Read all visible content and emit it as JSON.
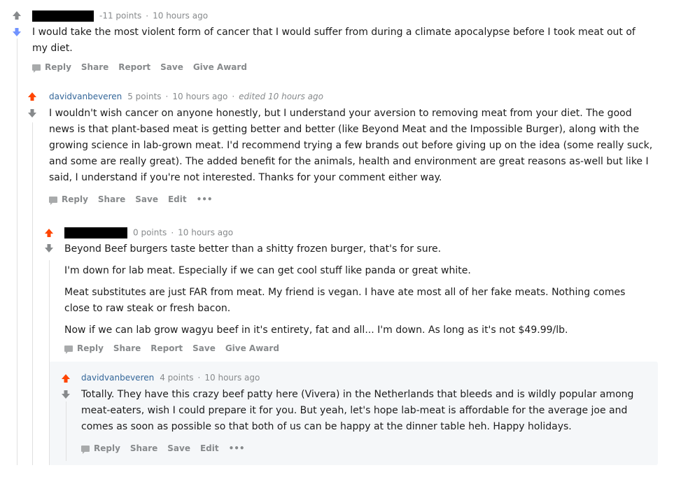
{
  "colors": {
    "upvoted": "#ff4500",
    "downvoted": "#7193ff",
    "neutral_arrow": "#878a8c",
    "username": "#336699"
  },
  "comment1": {
    "username": "",
    "points": "-11 points",
    "time": "10 hours ago",
    "vote": "downvoted",
    "paragraphs": [
      "I would take the most violent form of cancer that I would suffer from during a climate apocalypse before I took meat out of my diet."
    ],
    "actions": [
      "Reply",
      "Share",
      "Report",
      "Save",
      "Give Award"
    ]
  },
  "comment2": {
    "username": "davidvanbeveren",
    "points": "5 points",
    "time": "10 hours ago",
    "edited": "edited 10 hours ago",
    "vote": "upvoted",
    "paragraphs": [
      "I wouldn't wish cancer on anyone honestly, but I understand your aversion to removing meat from your diet. The good news is that plant-based meat is getting better and better (like Beyond Meat and the Impossible Burger), along with the growing science in lab-grown meat. I'd recommend trying a few brands out before giving up on the idea (some really suck, and some are really great). The added benefit for the animals, health and environment are great reasons as-well but like I said, I understand if you're not interested. Thanks for your comment either way."
    ],
    "actions": [
      "Reply",
      "Share",
      "Save",
      "Edit",
      "•••"
    ]
  },
  "comment3": {
    "username": "",
    "points": "0 points",
    "time": "10 hours ago",
    "vote": "upvoted",
    "paragraphs": [
      "Beyond Beef burgers taste better than a shitty frozen burger, that's for sure.",
      "I'm down for lab meat. Especially if we can get cool stuff like panda or great white.",
      "Meat substitutes are just FAR from meat. My friend is vegan. I have ate most all of her fake meats. Nothing comes close to raw steak or fresh bacon.",
      "Now if we can lab grow wagyu beef in it's entirety, fat and all... I'm down. As long as it's not $49.99/lb."
    ],
    "actions": [
      "Reply",
      "Share",
      "Report",
      "Save",
      "Give Award"
    ]
  },
  "comment4": {
    "username": "davidvanbeveren",
    "points": "4 points",
    "time": "10 hours ago",
    "vote": "upvoted",
    "paragraphs": [
      "Totally. They have this crazy beef patty here (Vivera) in the Netherlands that bleeds and is wildly popular among meat-eaters, wish I could prepare it for you. But yeah, let's hope lab-meat is affordable for the average joe and comes as soon as possible so that both of us can be happy at the dinner table heh. Happy holidays."
    ],
    "actions": [
      "Reply",
      "Share",
      "Save",
      "Edit",
      "•••"
    ]
  }
}
